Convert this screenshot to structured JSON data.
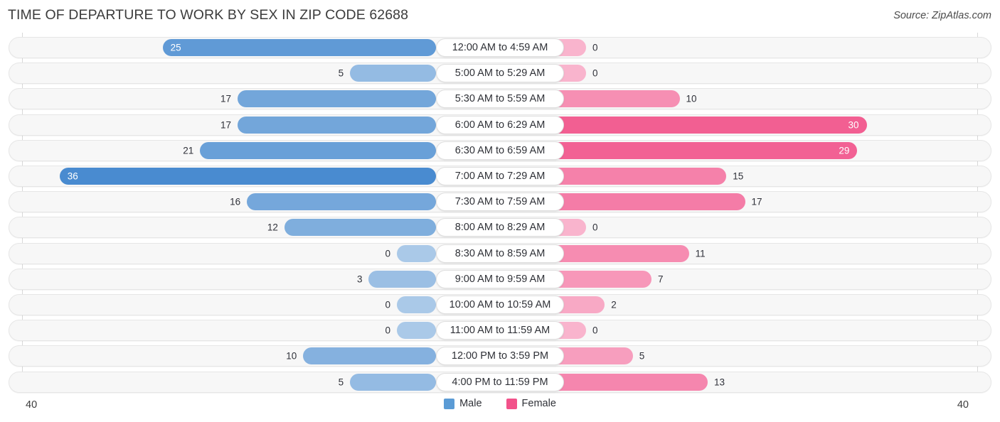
{
  "header": {
    "title": "TIME OF DEPARTURE TO WORK BY SEX IN ZIP CODE 62688",
    "source": "Source: ZipAtlas.com"
  },
  "legend": {
    "male_label": "Male",
    "female_label": "Female",
    "male_color": "#5b9bd5",
    "female_color": "#f2528a"
  },
  "axis": {
    "left_max": "40",
    "right_max": "40"
  },
  "chart_data": {
    "type": "bar",
    "title": "TIME OF DEPARTURE TO WORK BY SEX IN ZIP CODE 62688",
    "orientation": "horizontal-diverging",
    "xlabel": "",
    "ylabel": "",
    "xlim": [
      40,
      40
    ],
    "grid": false,
    "legend_position": "bottom-center",
    "categories": [
      "12:00 AM to 4:59 AM",
      "5:00 AM to 5:29 AM",
      "5:30 AM to 5:59 AM",
      "6:00 AM to 6:29 AM",
      "6:30 AM to 6:59 AM",
      "7:00 AM to 7:29 AM",
      "7:30 AM to 7:59 AM",
      "8:00 AM to 8:29 AM",
      "8:30 AM to 8:59 AM",
      "9:00 AM to 9:59 AM",
      "10:00 AM to 10:59 AM",
      "11:00 AM to 11:59 AM",
      "12:00 PM to 3:59 PM",
      "4:00 PM to 11:59 PM"
    ],
    "series": [
      {
        "name": "Male",
        "values": [
          25,
          5,
          17,
          17,
          21,
          36,
          16,
          12,
          0,
          3,
          0,
          0,
          10,
          5
        ]
      },
      {
        "name": "Female",
        "values": [
          0,
          0,
          10,
          30,
          29,
          15,
          17,
          0,
          11,
          7,
          2,
          0,
          5,
          13
        ]
      }
    ]
  },
  "rows": [
    {
      "label": "12:00 AM to 4:59 AM",
      "male": "25",
      "female": "0"
    },
    {
      "label": "5:00 AM to 5:29 AM",
      "male": "5",
      "female": "0"
    },
    {
      "label": "5:30 AM to 5:59 AM",
      "male": "17",
      "female": "10"
    },
    {
      "label": "6:00 AM to 6:29 AM",
      "male": "17",
      "female": "30"
    },
    {
      "label": "6:30 AM to 6:59 AM",
      "male": "21",
      "female": "29"
    },
    {
      "label": "7:00 AM to 7:29 AM",
      "male": "36",
      "female": "15"
    },
    {
      "label": "7:30 AM to 7:59 AM",
      "male": "16",
      "female": "17"
    },
    {
      "label": "8:00 AM to 8:29 AM",
      "male": "12",
      "female": "0"
    },
    {
      "label": "8:30 AM to 8:59 AM",
      "male": "0",
      "female": "11"
    },
    {
      "label": "9:00 AM to 9:59 AM",
      "male": "3",
      "female": "7"
    },
    {
      "label": "10:00 AM to 10:59 AM",
      "male": "0",
      "female": "2"
    },
    {
      "label": "11:00 AM to 11:59 AM",
      "male": "0",
      "female": "0"
    },
    {
      "label": "12:00 PM to 3:59 PM",
      "male": "10",
      "female": "5"
    },
    {
      "label": "4:00 PM to 11:59 PM",
      "male": "5",
      "female": "13"
    }
  ]
}
